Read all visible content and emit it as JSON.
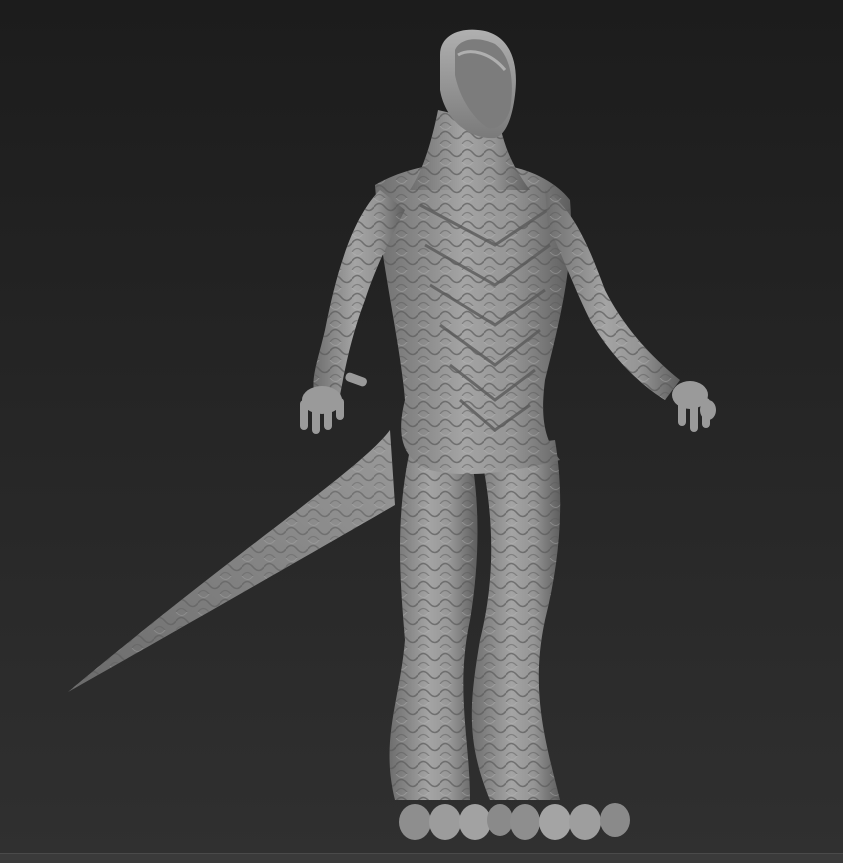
{
  "viewport": {
    "background": "#262626",
    "material_color": "#9a9a9a",
    "subject": "sculpted-reptile-figure"
  }
}
